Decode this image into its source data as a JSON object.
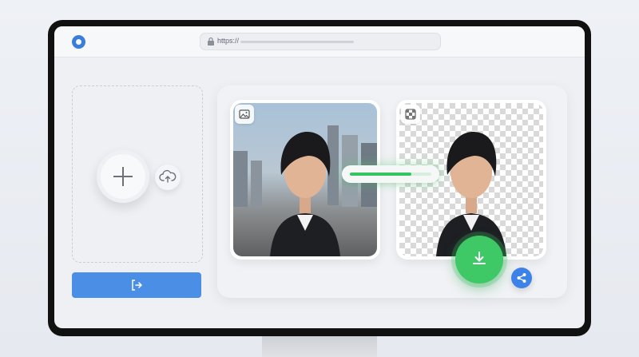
{
  "browser": {
    "url_prefix": "https://",
    "logo": "app-logo-icon"
  },
  "upload": {
    "add_icon": "plus-icon",
    "cloud_icon": "cloud-upload-icon",
    "action_icon": "export-arrow-icon"
  },
  "compare": {
    "original_badge_icon": "image-icon",
    "cutout_badge_icon": "transparency-grid-icon",
    "progress": 0.75,
    "download_icon": "download-icon",
    "share_icon": "share-icon"
  },
  "colors": {
    "primary": "#4a8ee6",
    "success": "#3fc866",
    "share": "#3c82e8"
  }
}
